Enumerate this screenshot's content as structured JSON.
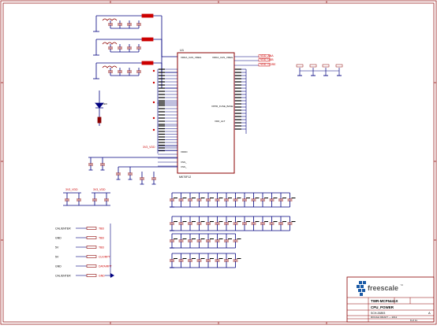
{
  "labels": {
    "u1": "U1",
    "mcu_top_left": "VDDA_CAS_VREG",
    "mcu_top_right": "VDDA_CAS_VREG",
    "net_vdd_a": "VDD_ANA",
    "net_vdd_b": "VDD_USB",
    "net_vdd_c": "VDD_CORE",
    "misc_pin": "VPPR_FUSE_BASE",
    "mid_pin": "VDD_ALT",
    "bottom_a": "VDDD",
    "bottom_b": "VSS_",
    "bottom_c": "VSS_",
    "left_net_a": "3V3_VDD",
    "left_net_b": "3V3_VDD",
    "left_net_c": "3V3_VDD",
    "u1_part": "MK70F12"
  },
  "connector_rows": [
    {
      "left": "CAL/ENTER",
      "mid": "TBD"
    },
    {
      "left": "GND",
      "mid": "TBD"
    },
    {
      "left": "5V",
      "mid": "TBD"
    },
    {
      "left": "5V",
      "mid": "CLK/RPT"
    },
    {
      "left": "GND",
      "mid": "DATA/RPT"
    },
    {
      "left": "CAL/ENTER",
      "mid": "GND"
    }
  ],
  "title_block": {
    "company": "freescale",
    "company_suffix": "™",
    "board": "TWR-MCF5441X",
    "sheet_title": "CPU_POWER",
    "doc_no": "SCH-26893",
    "rev": "A",
    "date_line": "ROUGH DRAFT — 2012",
    "sheet": "8 of 11"
  },
  "colors": {
    "wire": "#00007f",
    "part": "#8b0000",
    "net_label": "#cc0000",
    "frame": "#8b0000"
  }
}
